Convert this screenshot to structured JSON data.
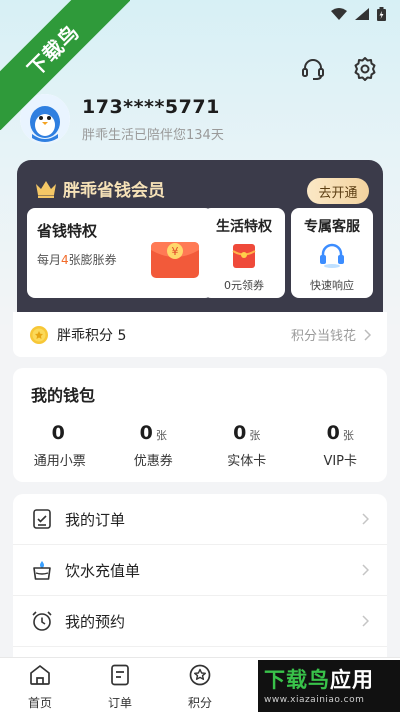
{
  "corner_ribbon": {
    "text": "下载鸟"
  },
  "profile": {
    "phone": "173****5771",
    "companion_text": "胖乖生活已陪伴您134天"
  },
  "vip": {
    "title": "胖乖省钱会员",
    "open_button": "去开通",
    "perk_savings": {
      "title": "省钱特权",
      "desc_prefix": "每月",
      "desc_highlight": "4",
      "desc_suffix": "张膨胀券"
    },
    "perk_life": {
      "title": "生活特权",
      "desc": "0元领券"
    },
    "perk_service": {
      "title": "专属客服",
      "desc": "快速响应"
    }
  },
  "points": {
    "label": "胖乖积分 5",
    "right_text": "积分当钱花"
  },
  "wallet": {
    "title": "我的钱包",
    "items": [
      {
        "value": "0",
        "unit": "",
        "label": "通用小票"
      },
      {
        "value": "0",
        "unit": "张",
        "label": "优惠券"
      },
      {
        "value": "0",
        "unit": "张",
        "label": "实体卡"
      },
      {
        "value": "0",
        "unit": "张",
        "label": "VIP卡"
      }
    ]
  },
  "menu": [
    {
      "label": "我的订单",
      "icon": "order-list-icon"
    },
    {
      "label": "饮水充值单",
      "icon": "water-icon"
    },
    {
      "label": "我的预约",
      "icon": "alarm-clock-icon"
    }
  ],
  "tabbar": [
    {
      "label": "首页",
      "icon": "home-icon"
    },
    {
      "label": "订单",
      "icon": "order-icon"
    },
    {
      "label": "积分",
      "icon": "star-icon"
    }
  ],
  "watermark": {
    "title_green": "下载鸟",
    "title_white": "应用",
    "url": "www.xiazainiao.com"
  },
  "colors": {
    "accent_orange": "#f26b2a",
    "vip_dark": "#3b3b4a",
    "vip_gold": "#f6e2b8",
    "ribbon_green": "#2f9a3a"
  }
}
